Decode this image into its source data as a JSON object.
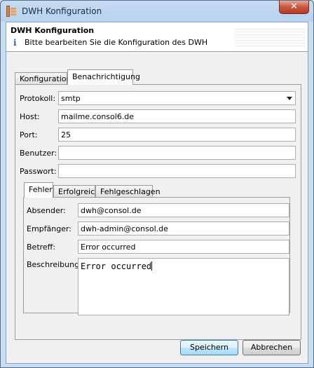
{
  "window": {
    "title": "DWH Konfiguration",
    "close_symbol": "✕"
  },
  "header": {
    "title": "DWH Konfiguration",
    "description": "Bitte bearbeiten Sie die Konfiguration des DWH"
  },
  "tabs": [
    {
      "label": "Konfiguration",
      "active": false
    },
    {
      "label": "Benachrichtigung",
      "active": true
    }
  ],
  "form": {
    "protocol": {
      "label": "Protokoll:",
      "value": "smtp"
    },
    "host": {
      "label": "Host:",
      "value": "mailme.consol6.de"
    },
    "port": {
      "label": "Port:",
      "value": "25"
    },
    "user": {
      "label": "Benutzer:",
      "value": ""
    },
    "password": {
      "label": "Passwort:",
      "value": ""
    }
  },
  "inner_tabs": [
    {
      "label": "Fehler",
      "active": true
    },
    {
      "label": "Erfolgreich",
      "active": false
    },
    {
      "label": "Fehlgeschlagen",
      "active": false
    }
  ],
  "mail": {
    "sender": {
      "label": "Absender:",
      "value": "dwh@consol.de"
    },
    "recipient": {
      "label": "Empfänger:",
      "value": "dwh-admin@consol.de"
    },
    "subject": {
      "label": "Betreff:",
      "value": "Error occurred"
    },
    "description": {
      "label": "Beschreibung:",
      "value": "Error occurred"
    }
  },
  "buttons": {
    "save": "Speichern",
    "cancel": "Abbrechen"
  }
}
